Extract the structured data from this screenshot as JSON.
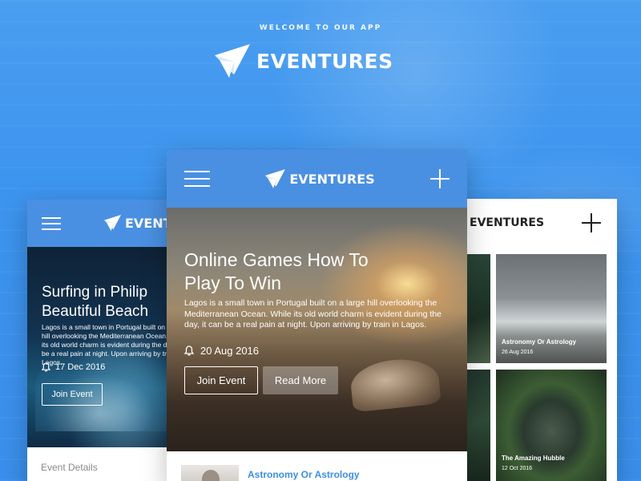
{
  "header": {
    "welcome": "WELCOME TO OUR APP",
    "brand": "EVENTURES"
  },
  "phone_left": {
    "brand": "EVENTURES",
    "title_line1": "Surfing in Philip",
    "title_line2": "Beautiful Beach",
    "description": "Lagos is a small town in Portugal built on a large hill overlooking the Mediterranean Ocean. While its old world charm is evident during the day, it can be a real pain at night. Upon arriving by train in Lagos.",
    "date": "17 Dec 2016",
    "join_label": "Join Event",
    "details_label": "Event Details"
  },
  "phone_center": {
    "brand": "EVENTURES",
    "title_line1": "Online Games How To",
    "title_line2": "Play To Win",
    "description": "Lagos is a small town in Portugal built on a large hill overlooking the Mediterranean Ocean. While its old world charm is evident during the day, it can be a real pain at night. Upon arriving by train in Lagos.",
    "date": "20 Aug 2016",
    "join_label": "Join Event",
    "read_label": "Read More",
    "list_item_title": "Astronomy Or Astrology"
  },
  "phone_right": {
    "brand": "EVENTURES",
    "tile_fragment": "es",
    "tiles": [
      {
        "title": "Astronomy Or Astrology",
        "date": "26 Aug 2016"
      },
      {
        "title": "The Amazing Hubble",
        "date": "12 Oct 2016"
      }
    ]
  },
  "colors": {
    "primary": "#4a90e2",
    "background": "#3d94ee",
    "link": "#3d8fe0"
  }
}
